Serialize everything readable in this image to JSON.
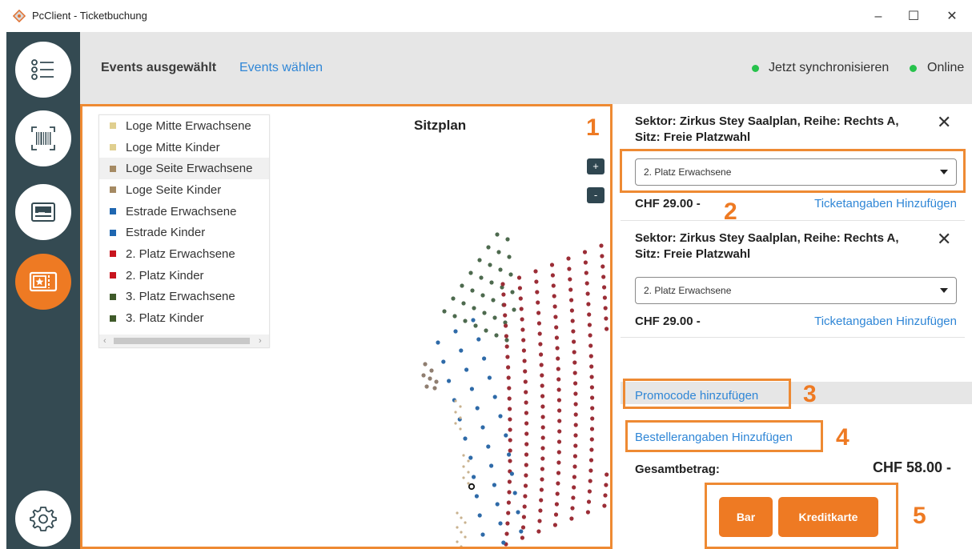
{
  "window": {
    "title": "PcClient - Ticketbuchung",
    "minimize": "–",
    "maximize": "☐",
    "close": "✕"
  },
  "sidebar": {
    "items": [
      {
        "icon": "list-icon"
      },
      {
        "icon": "barcode-icon"
      },
      {
        "icon": "ticket-card-icon"
      },
      {
        "icon": "ticket-icon",
        "active": true
      },
      {
        "icon": "gear-icon"
      }
    ]
  },
  "header": {
    "title": "Events ausgewählt",
    "link": "Events wählen",
    "sync": "Jetzt synchronisieren",
    "status": "Online"
  },
  "plan": {
    "title": "Sitzplan",
    "zoom_in": "+",
    "zoom_out": "-",
    "legend": [
      {
        "label": "Loge Mitte Erwachsene",
        "color": "#e0cf8f"
      },
      {
        "label": "Loge Mitte Kinder",
        "color": "#e0cf8f"
      },
      {
        "label": "Loge Seite Erwachsene",
        "color": "#a58a63"
      },
      {
        "label": "Loge Seite Kinder",
        "color": "#a58a63"
      },
      {
        "label": "Estrade Erwachsene",
        "color": "#1f67b1"
      },
      {
        "label": "Estrade Kinder",
        "color": "#1f67b1"
      },
      {
        "label": "2. Platz Erwachsene",
        "color": "#c8141e"
      },
      {
        "label": "2. Platz Kinder",
        "color": "#c8141e"
      },
      {
        "label": "3. Platz Erwachsene",
        "color": "#3f5a2a"
      },
      {
        "label": "3. Platz Kinder",
        "color": "#3f5a2a"
      }
    ],
    "seat_colors": {
      "green": "#4d6a4e",
      "red": "#9b2d36",
      "blue": "#2e6aa8",
      "brown": "#8f7e70",
      "tan": "#c9b28f"
    }
  },
  "annotations": [
    "1",
    "2",
    "3",
    "4",
    "5"
  ],
  "tickets": [
    {
      "header": "Sektor: Zirkus Stey Saalplan, Reihe: Rechts A, Sitz: Freie Platzwahl",
      "category": "2. Platz Erwachsene",
      "price": "CHF 29.00 -",
      "link": "Ticketangaben Hinzufügen"
    },
    {
      "header": "Sektor: Zirkus Stey Saalplan, Reihe: Rechts A, Sitz: Freie Platzwahl",
      "category": "2. Platz Erwachsene",
      "price": "CHF 29.00 -",
      "link": "Ticketangaben Hinzufügen"
    }
  ],
  "promo": "Promocode hinzufügen",
  "order_details": "Bestellerangaben Hinzufügen",
  "total": {
    "label": "Gesamtbetrag:",
    "value": "CHF 58.00 -"
  },
  "payment": {
    "cash": "Bar",
    "card": "Kreditkarte"
  }
}
